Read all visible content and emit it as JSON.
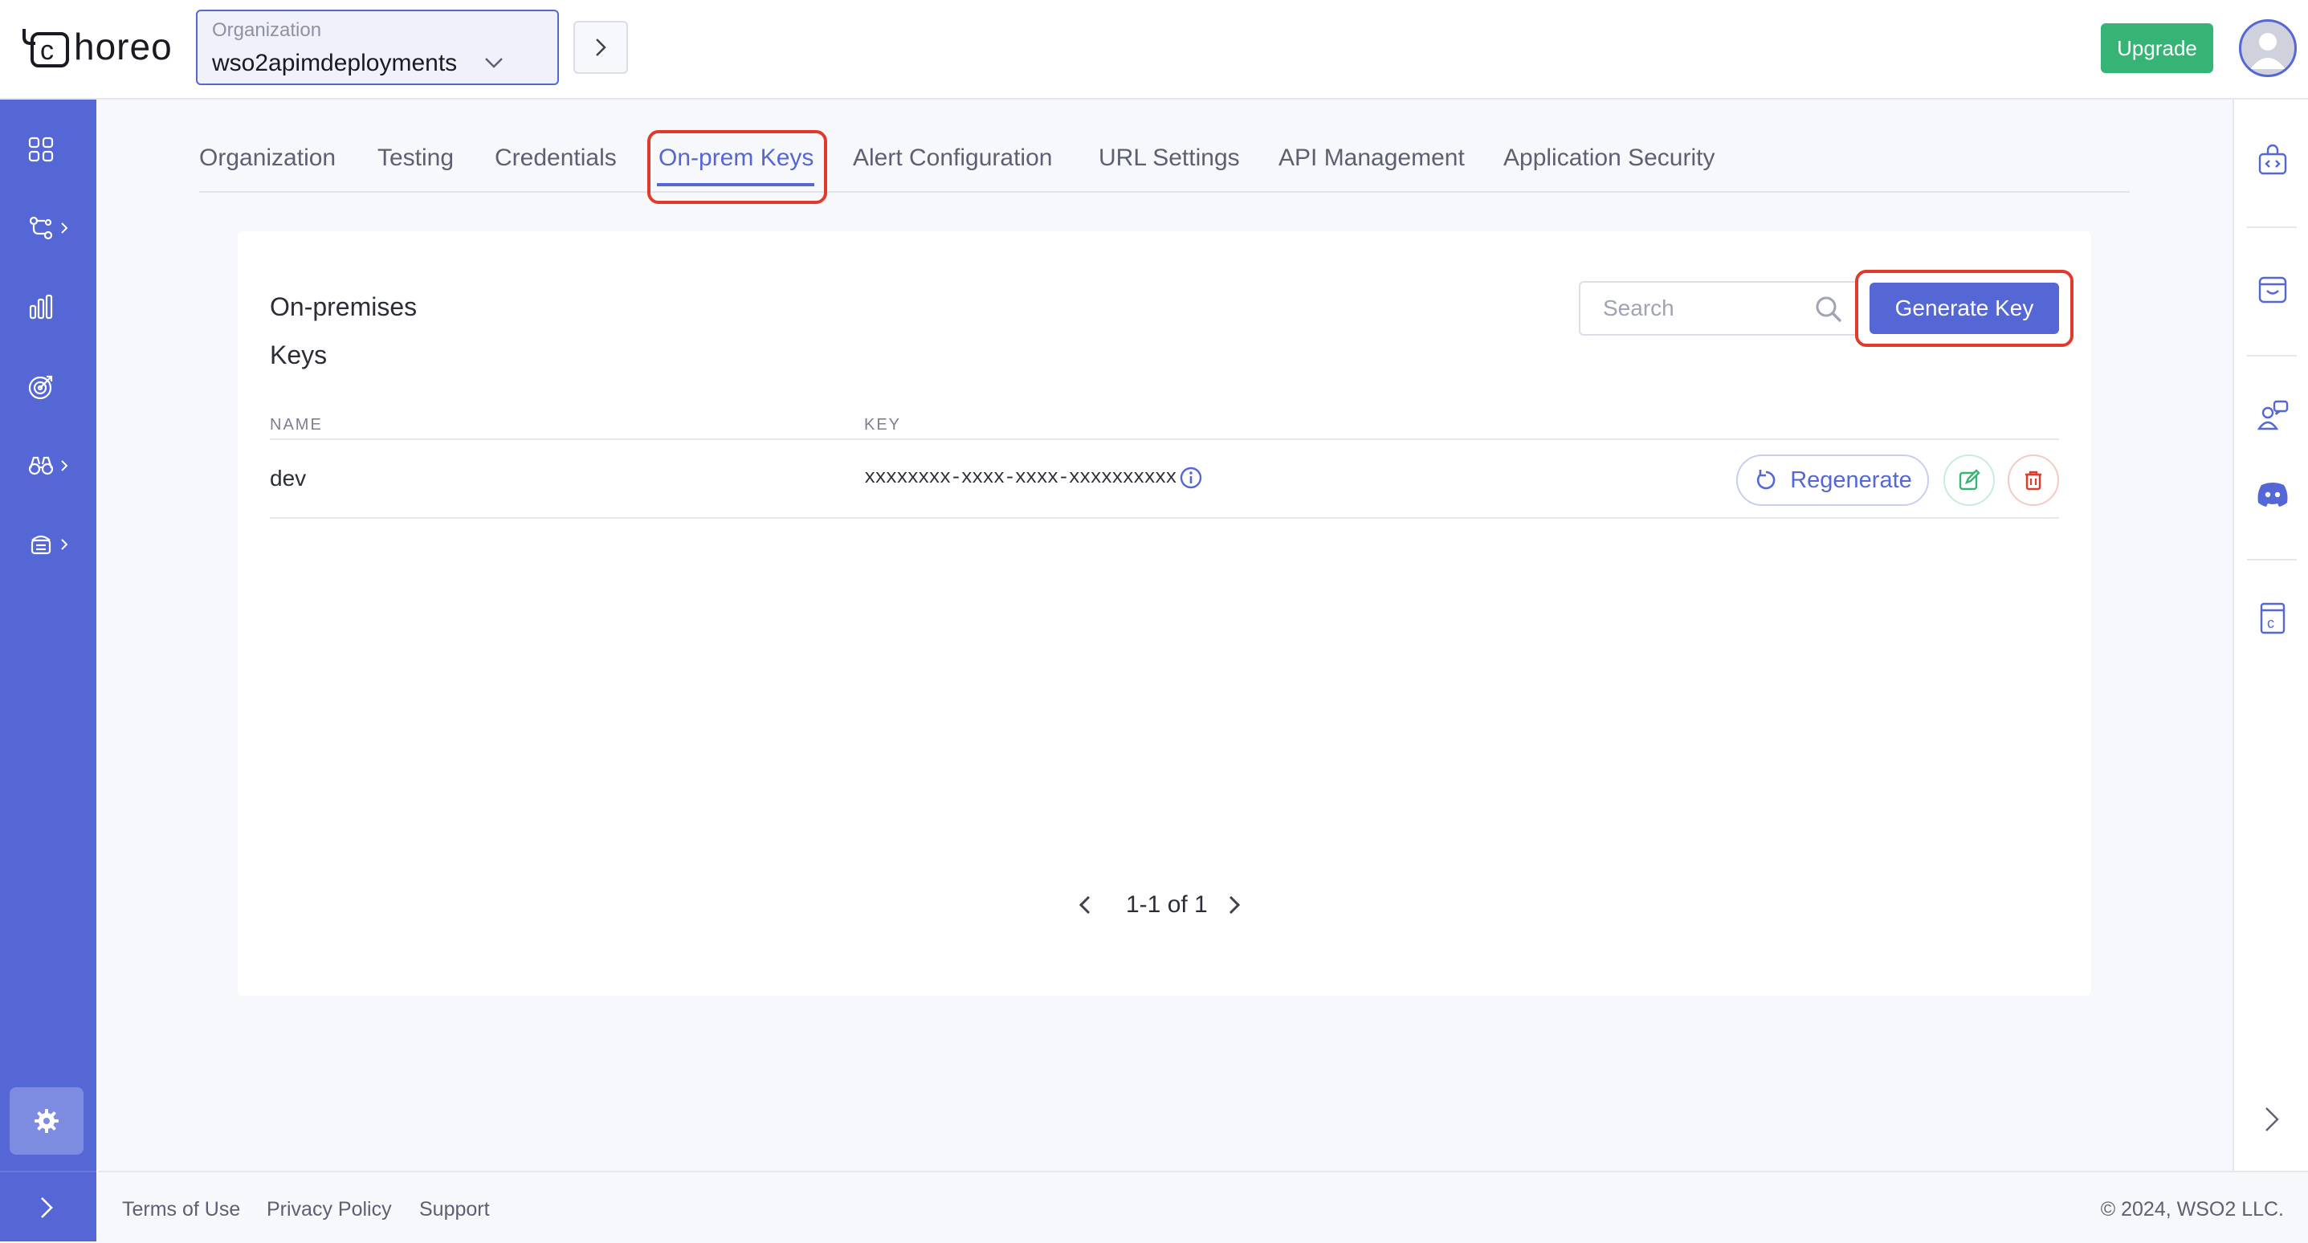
{
  "app": {
    "logo_text": "horeo",
    "logo_letter": "c"
  },
  "header": {
    "org_label": "Organization",
    "org_value": "wso2apimdeployments",
    "upgrade_label": "Upgrade"
  },
  "tabs": [
    {
      "label": "Organization"
    },
    {
      "label": "Testing"
    },
    {
      "label": "Credentials"
    },
    {
      "label": "On-prem Keys",
      "active": true
    },
    {
      "label": "Alert Configuration"
    },
    {
      "label": "URL Settings"
    },
    {
      "label": "API Management"
    },
    {
      "label": "Application Security"
    }
  ],
  "card": {
    "title_line1": "On-premises",
    "title_line2": "Keys",
    "search_placeholder": "Search",
    "generate_label": "Generate Key",
    "columns": {
      "name": "NAME",
      "key": "KEY"
    },
    "rows": [
      {
        "name": "dev",
        "key": "xxxxxxxx-xxxx-xxxx-xxxxxxxxxx",
        "regenerate_label": "Regenerate"
      }
    ],
    "pagination": "1-1 of 1"
  },
  "footer": {
    "terms": "Terms of Use",
    "privacy": "Privacy Policy",
    "support": "Support",
    "copyright": "© 2024, WSO2 LLC."
  },
  "colors": {
    "primary": "#5567d5",
    "success": "#36b475",
    "danger": "#e03a2b",
    "highlight": "#e03a2b"
  },
  "icons": {
    "sidebar": [
      "grid-icon",
      "flow-icon",
      "bar-chart-icon",
      "target-icon",
      "binoculars-icon",
      "database-icon",
      "gear-icon",
      "chevron-right-icon"
    ],
    "rightrail": [
      "code-bag-icon",
      "cart-icon",
      "support-chat-icon",
      "discord-icon",
      "choreo-book-icon",
      "chevron-right-icon"
    ]
  }
}
